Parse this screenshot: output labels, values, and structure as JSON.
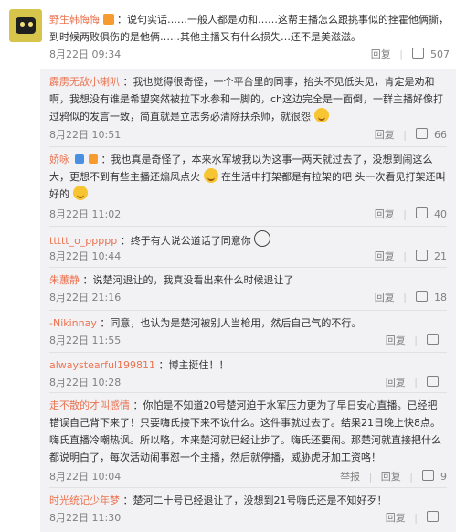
{
  "top": {
    "username": "野生韩悔悔",
    "text": "：说句实话……一般人都是劝和……这帮主播怎么跟挑事似的挫霍他俩撕，到时候两败俱伤的是他俩……其他主播又有什么损失…还不是美滋滋。",
    "time": "8月22日 09:34",
    "actions": {
      "reply": "回复",
      "likes": "507"
    }
  },
  "comments": [
    {
      "username": "霹雳无敌小喇叭",
      "text": "：我也觉得很奇怪，一个平台里的同事，抬头不见低头见，肯定是劝和啊，我想没有谁是希望突然被拉下水参和一脚的，ch这边完全是一面倒，一群主播好像打过鸦似的发言一致，简直就是立志务必清除扶杀师，就很怨",
      "time": "8月22日 10:51",
      "actions": {
        "reply": "回复",
        "likes": "66"
      }
    },
    {
      "username": "娇咏",
      "text": "：我也真是奇怪了，本来水军坡我以为这事一两天就过去了，没想到闹这么大，更想不到有些主播还煽风点火",
      "text2": "在生活中打架都是有拉架的吧 头一次看见打架还叫好的",
      "time": "8月22日 11:02",
      "actions": {
        "reply": "回复",
        "likes": "40"
      }
    },
    {
      "username": "ttttt_o_ppppp",
      "text": "：终于有人说公道话了同意你",
      "time": "8月22日 10:44",
      "actions": {
        "reply": "回复",
        "likes": "21"
      }
    },
    {
      "username": "朱蕙静",
      "text": "：说楚河退让的，我真没看出来什么时候退让了",
      "time": "8月22日 21:16",
      "actions": {
        "reply": "回复",
        "likes": "18"
      }
    },
    {
      "username": "-Nikinnay",
      "text": "：同意，也认为是楚河被别人当枪用，然后自己气的不行。",
      "time": "8月22日 11:55",
      "actions": {
        "reply": "回复",
        "likes": ""
      }
    },
    {
      "username": "alwaystearful199811",
      "text": "：博主挺住！！",
      "time": "8月22日 10:28",
      "actions": {
        "reply": "回复",
        "likes": ""
      }
    },
    {
      "username": "走不散的才叫感情",
      "text": "：你怕是不知道20号楚河迫于水军压力更为了早日安心直播。已经把错误自己背下来了！只要嗨氏接下来不说什么。这件事就过去了。结果21日晚上快8点。嗨氏直播冷嘲热讽。所以略，本来楚河就已经让步了。嗨氏还要闹。那楚河就直接把什么都说明白了，每次活动闹事怼一个主播，然后就停播，威胁虎牙加工资咯！",
      "time": "8月22日 10:04",
      "actions": {
        "report": "举报",
        "reply": "回复",
        "likes": "9"
      }
    },
    {
      "username": "时光统记少年梦",
      "text": "：楚河二十号已经退让了，没想到21号嗨氏还是不知好歹！",
      "time": "8月22日 11:30",
      "actions": {
        "reply": "回复",
        "likes": ""
      }
    }
  ]
}
